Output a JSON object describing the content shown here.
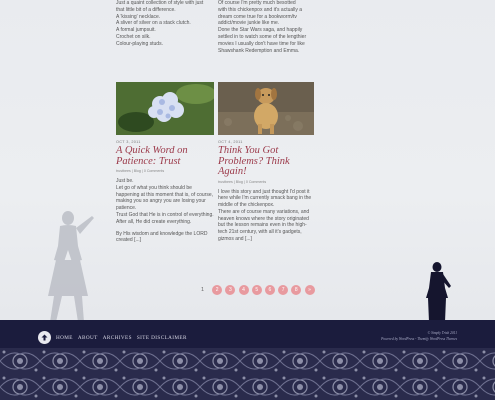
{
  "top_columns": {
    "left_lines": [
      "Just a quaint collection of style with just",
      "that little bit of a difference.",
      "A 'kissing' necklace.",
      "A sliver of silver on a stack clutch.",
      "A formal jumpsuit.",
      "Crochet on silk.",
      "Colour-playing studs."
    ],
    "right_lines": [
      "Of course I'm pretty much besotted",
      "with this chickenpox and it's actually a",
      "dream come true for a bookworm/tv",
      "addict/movie junkie like me.",
      "Done the Star Wars saga, and happily",
      "settled in to watch some of the lengthier",
      "movies I usually don't have time for like",
      "Shawshank Redemption and Emma."
    ]
  },
  "posts": [
    {
      "image_icon": "hydrangea-photo-icon",
      "date": "OCT 3, 2011",
      "title": "A Quick Word on Patience: Trust",
      "meta": "trustbees | Blog | 0 Comments",
      "paragraphs": [
        "Just be.",
        "Let go of what you think should be happening at this moment that is, of course, making you so angry you are losing your patience.",
        "Trust God that He is in control of everything. After all, He did create everything.",
        "By His wisdom and knowledge the LORD created [...]"
      ]
    },
    {
      "image_icon": "puppy-photo-icon",
      "date": "OCT 4, 2011",
      "title": "Think You Got Problems? Think Again!",
      "meta": "trustbees | Blog | 0 Comments",
      "paragraphs": [
        "I love this story and just thought I'd post it here while I'm currently smack bang in the middle of the chickenpox.",
        "There are of course many variations, and heaven knows where the story originated but the lesson remains even in the high-tech 21st century, with all it's gadgets, gizmos and [...]"
      ]
    }
  ],
  "pagination": {
    "current": "1",
    "pages": [
      "2",
      "3",
      "4",
      "5",
      "6",
      "7",
      "8",
      "»"
    ],
    "accent": "#e89a9f"
  },
  "footer": {
    "nav": [
      "HOME",
      "ABOUT",
      "ARCHIVES",
      "SITE DISCLAIMER"
    ],
    "copyright": "© Simply Trish 2011",
    "powered": "Powered by WordPress - Themify WordPress Themes",
    "background": "#1b1c3d"
  },
  "colors": {
    "title": "#9c3a4a",
    "page_bg": "#eef0f3"
  }
}
